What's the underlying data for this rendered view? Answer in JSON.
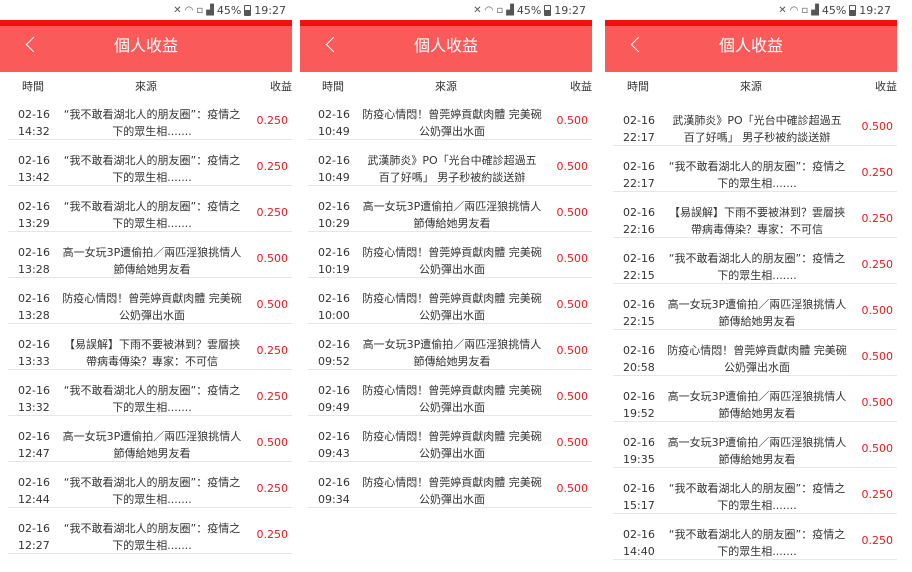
{
  "status": {
    "battery": "45%",
    "time": "19:27"
  },
  "header": {
    "title": "個人收益"
  },
  "columns": {
    "time": "時間",
    "source": "來源",
    "earnings": "收益"
  },
  "screens": [
    {
      "rows": [
        {
          "date": "02-16",
          "time": "14:32",
          "source": "“我不敢看湖北人的朋友圈”：疫情之下的眾生相.......",
          "earn": "0.250"
        },
        {
          "date": "02-16",
          "time": "13:42",
          "source": "“我不敢看湖北人的朋友圈”：疫情之下的眾生相.......",
          "earn": "0.250"
        },
        {
          "date": "02-16",
          "time": "13:29",
          "source": "“我不敢看湖北人的朋友圈”：疫情之下的眾生相.......",
          "earn": "0.250"
        },
        {
          "date": "02-16",
          "time": "13:28",
          "source": "高一女玩3P遭偷拍／兩匹淫狼挑情人節傳給她男友看",
          "earn": "0.500"
        },
        {
          "date": "02-16",
          "time": "13:28",
          "source": "防疫心情悶！曾莞婷貢獻肉體 完美碗公奶彈出水面",
          "earn": "0.500"
        },
        {
          "date": "02-16",
          "time": "13:33",
          "source": "【易誤解】下雨不要被淋到？雲層挾帶病毒傳染？專家：不可信",
          "earn": "0.250"
        },
        {
          "date": "02-16",
          "time": "13:32",
          "source": "“我不敢看湖北人的朋友圈”：疫情之下的眾生相.......",
          "earn": "0.250"
        },
        {
          "date": "02-16",
          "time": "12:47",
          "source": "高一女玩3P遭偷拍／兩匹淫狼挑情人節傳給她男友看",
          "earn": "0.500"
        },
        {
          "date": "02-16",
          "time": "12:44",
          "source": "“我不敢看湖北人的朋友圈”：疫情之下的眾生相.......",
          "earn": "0.250"
        },
        {
          "date": "02-16",
          "time": "12:27",
          "source": "“我不敢看湖北人的朋友圈”：疫情之下的眾生相.......",
          "earn": "0.250"
        }
      ]
    },
    {
      "rows": [
        {
          "date": "02-16",
          "time": "10:49",
          "source": "防疫心情悶！曾莞婷貢獻肉體 完美碗公奶彈出水面",
          "earn": "0.500"
        },
        {
          "date": "02-16",
          "time": "10:49",
          "source": "武漢肺炎》PO「光台中確診超過五百了好嗎」 男子秒被約談送辦",
          "earn": "0.500"
        },
        {
          "date": "02-16",
          "time": "10:29",
          "source": "高一女玩3P遭偷拍／兩匹淫狼挑情人節傳給她男友看",
          "earn": "0.500"
        },
        {
          "date": "02-16",
          "time": "10:19",
          "source": "防疫心情悶！曾莞婷貢獻肉體 完美碗公奶彈出水面",
          "earn": "0.500"
        },
        {
          "date": "02-16",
          "time": "10:00",
          "source": "防疫心情悶！曾莞婷貢獻肉體 完美碗公奶彈出水面",
          "earn": "0.500"
        },
        {
          "date": "02-16",
          "time": "09:52",
          "source": "高一女玩3P遭偷拍／兩匹淫狼挑情人節傳給她男友看",
          "earn": "0.500"
        },
        {
          "date": "02-16",
          "time": "09:49",
          "source": "防疫心情悶！曾莞婷貢獻肉體 完美碗公奶彈出水面",
          "earn": "0.500"
        },
        {
          "date": "02-16",
          "time": "09:43",
          "source": "防疫心情悶！曾莞婷貢獻肉體 完美碗公奶彈出水面",
          "earn": "0.500"
        },
        {
          "date": "02-16",
          "time": "09:34",
          "source": "防疫心情悶！曾莞婷貢獻肉體 完美碗公奶彈出水面",
          "earn": "0.500"
        }
      ]
    },
    {
      "rows": [
        {
          "date": "02-16",
          "time": "22:17",
          "source": "武漢肺炎》PO「光台中確診超過五百了好嗎」 男子秒被約談送辦",
          "earn": "0.500"
        },
        {
          "date": "02-16",
          "time": "22:17",
          "source": "“我不敢看湖北人的朋友圈”：疫情之下的眾生相.......",
          "earn": "0.250"
        },
        {
          "date": "02-16",
          "time": "22:16",
          "source": "【易誤解】下雨不要被淋到？雲層挾帶病毒傳染？專家：不可信",
          "earn": "0.250"
        },
        {
          "date": "02-16",
          "time": "22:15",
          "source": "“我不敢看湖北人的朋友圈”：疫情之下的眾生相.......",
          "earn": "0.250"
        },
        {
          "date": "02-16",
          "time": "22:15",
          "source": "高一女玩3P遭偷拍／兩匹淫狼挑情人節傳給她男友看",
          "earn": "0.500"
        },
        {
          "date": "02-16",
          "time": "20:58",
          "source": "防疫心情悶！曾莞婷貢獻肉體 完美碗公奶彈出水面",
          "earn": "0.500"
        },
        {
          "date": "02-16",
          "time": "19:52",
          "source": "高一女玩3P遭偷拍／兩匹淫狼挑情人節傳給她男友看",
          "earn": "0.500"
        },
        {
          "date": "02-16",
          "time": "19:35",
          "source": "高一女玩3P遭偷拍／兩匹淫狼挑情人節傳給她男友看",
          "earn": "0.500"
        },
        {
          "date": "02-16",
          "time": "15:17",
          "source": "“我不敢看湖北人的朋友圈”：疫情之下的眾生相.......",
          "earn": "0.250"
        },
        {
          "date": "02-16",
          "time": "14:40",
          "source": "“我不敢看湖北人的朋友圈”：疫情之下的眾生相.......",
          "earn": "0.250"
        }
      ]
    }
  ]
}
